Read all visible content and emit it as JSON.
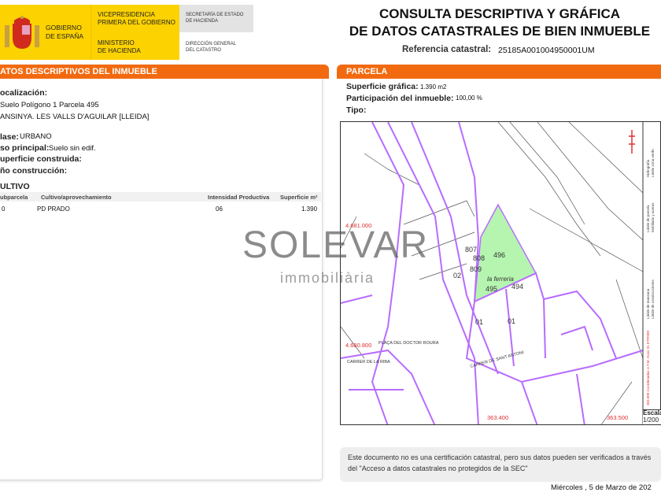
{
  "header": {
    "gov_lines": [
      "GOBIERNO",
      "DE ESPAÑA"
    ],
    "vice_lines": [
      "VICEPRESIDENCIA",
      "PRIMERA DEL GOBIERNO"
    ],
    "ministry_lines": [
      "MINISTERIO",
      "DE HACIENDA"
    ],
    "secretaria_lines": [
      "SECRETARÍA DE ESTADO",
      "DE HACIENDA"
    ],
    "direccion_lines": [
      "DIRECCIÓN GENERAL",
      "DEL CATASTRO"
    ],
    "title_lines": [
      "CONSULTA DESCRIPTIVA Y GRÁFICA",
      "DE DATOS CATASTRALES DE BIEN INMUEBLE"
    ],
    "ref_label": "Referencia catastral:",
    "ref_value": "25185A001004950001UM"
  },
  "left": {
    "section_title": "ATOS DESCRIPTIVOS DEL INMUEBLE",
    "loc_label": "ocalización:",
    "loc_line1": "Suelo Polígono 1 Parcela 495",
    "loc_line2": "ANSINYA. LES VALLS D'AGUILAR [LLEIDA]",
    "clase_label": "lase:",
    "clase_value": "URBANO",
    "uso_label": "so principal:",
    "uso_value": "Suelo sin edif.",
    "sup_label": "uperficie construida:",
    "anio_label": "ño construcción:",
    "cultivo_title": "ULTIVO",
    "columns": [
      "ubparcela",
      "Cultivo/aprovechamiento",
      "Intensidad Productiva",
      "Superficie m²"
    ],
    "rows": [
      [
        "0",
        "PD PRADO",
        "06",
        "1.390"
      ]
    ]
  },
  "right": {
    "section_title": "PARCELA",
    "sup_label": "Superficie gráfica:",
    "sup_value": "1.390 m2",
    "part_label": "Participación del inmueble:",
    "part_value": "100,00 %",
    "tipo_label": "Tipo:"
  },
  "map": {
    "parcel_labels": [
      "807",
      "808",
      "809",
      "496",
      "495",
      "494",
      "01",
      "01",
      "02"
    ],
    "place": "la ferreria",
    "streets": [
      "CARRER DE SANT ANTONI",
      "PLAÇA DEL DOCTOR ROURA",
      "CARRER DE LA RIBA"
    ],
    "coords": [
      "4.681.000",
      "4.680.800",
      "363.400",
      "363.500"
    ],
    "legend": [
      "363.500 Coordenadas U.T.M. Huso 31 ETRS89",
      "Límite de manzana",
      "Límite de construcciones",
      "Límite de parcela",
      "Mobiliario y aceras",
      "Hidrografía",
      "Límite zona verde"
    ],
    "scale_label": "Escala",
    "scale_value": "1/200",
    "colors": {
      "parcel_line": "#b86bff",
      "highlight": "#b5f5b0",
      "coords": "#e03030"
    }
  },
  "footer": {
    "note": "Este documento no es una certificación catastral, pero sus datos pueden ser verificados a través del \"Acceso a datos catastrales no protegidos de la SEC\"",
    "date": "Miércoles , 5 de Marzo de 202"
  },
  "watermark": {
    "brand": "SOLEVAR",
    "sub": "immobiliària"
  }
}
